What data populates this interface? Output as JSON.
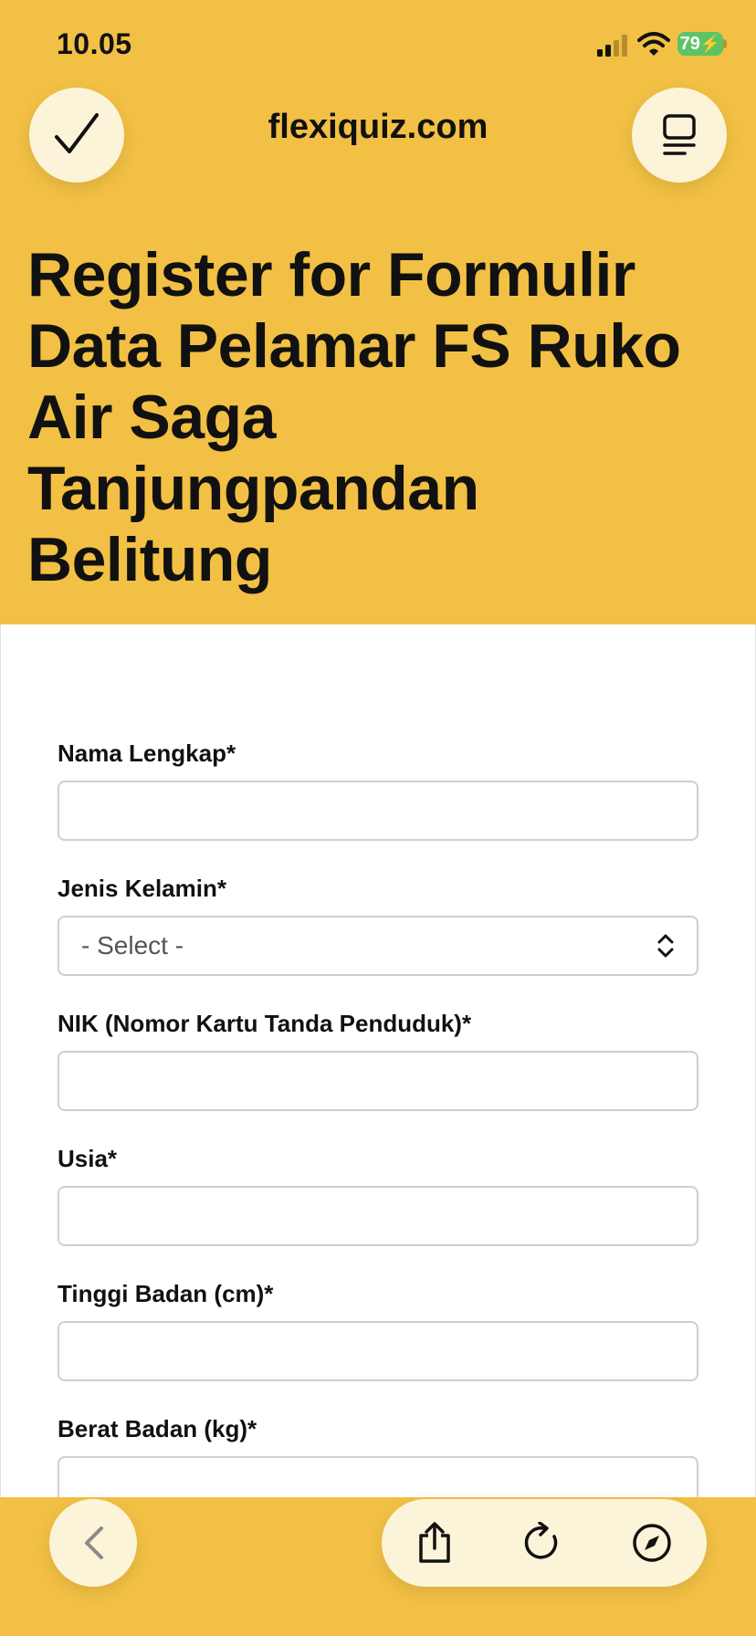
{
  "status_bar": {
    "time": "10.05",
    "battery": "79",
    "icons": [
      "signal-icon",
      "wifi-icon",
      "battery-icon"
    ]
  },
  "browser": {
    "url": "flexiquiz.com",
    "icons": [
      "checkmark-icon",
      "tabs-icon"
    ]
  },
  "page": {
    "title": "Register for Formulir Data Pelamar FS Ruko Air Saga Tanjungpandan Belitung"
  },
  "form": {
    "fields": [
      {
        "label": "Nama Lengkap*",
        "value": ""
      },
      {
        "label": "Jenis Kelamin*",
        "value": "- Select -"
      },
      {
        "label": "NIK (Nomor Kartu Tanda Penduduk)*",
        "value": ""
      },
      {
        "label": "Usia*",
        "value": ""
      },
      {
        "label": "Tinggi Badan (cm)*",
        "value": ""
      },
      {
        "label": "Berat Badan (kg)*",
        "value": ""
      }
    ]
  },
  "toolbar": {
    "icons": [
      "back-icon",
      "share-icon",
      "reload-icon",
      "compass-icon"
    ]
  },
  "colors": {
    "accent": "#F2C044",
    "button_bg": "#FCF4D8",
    "battery": "#5DC466"
  }
}
